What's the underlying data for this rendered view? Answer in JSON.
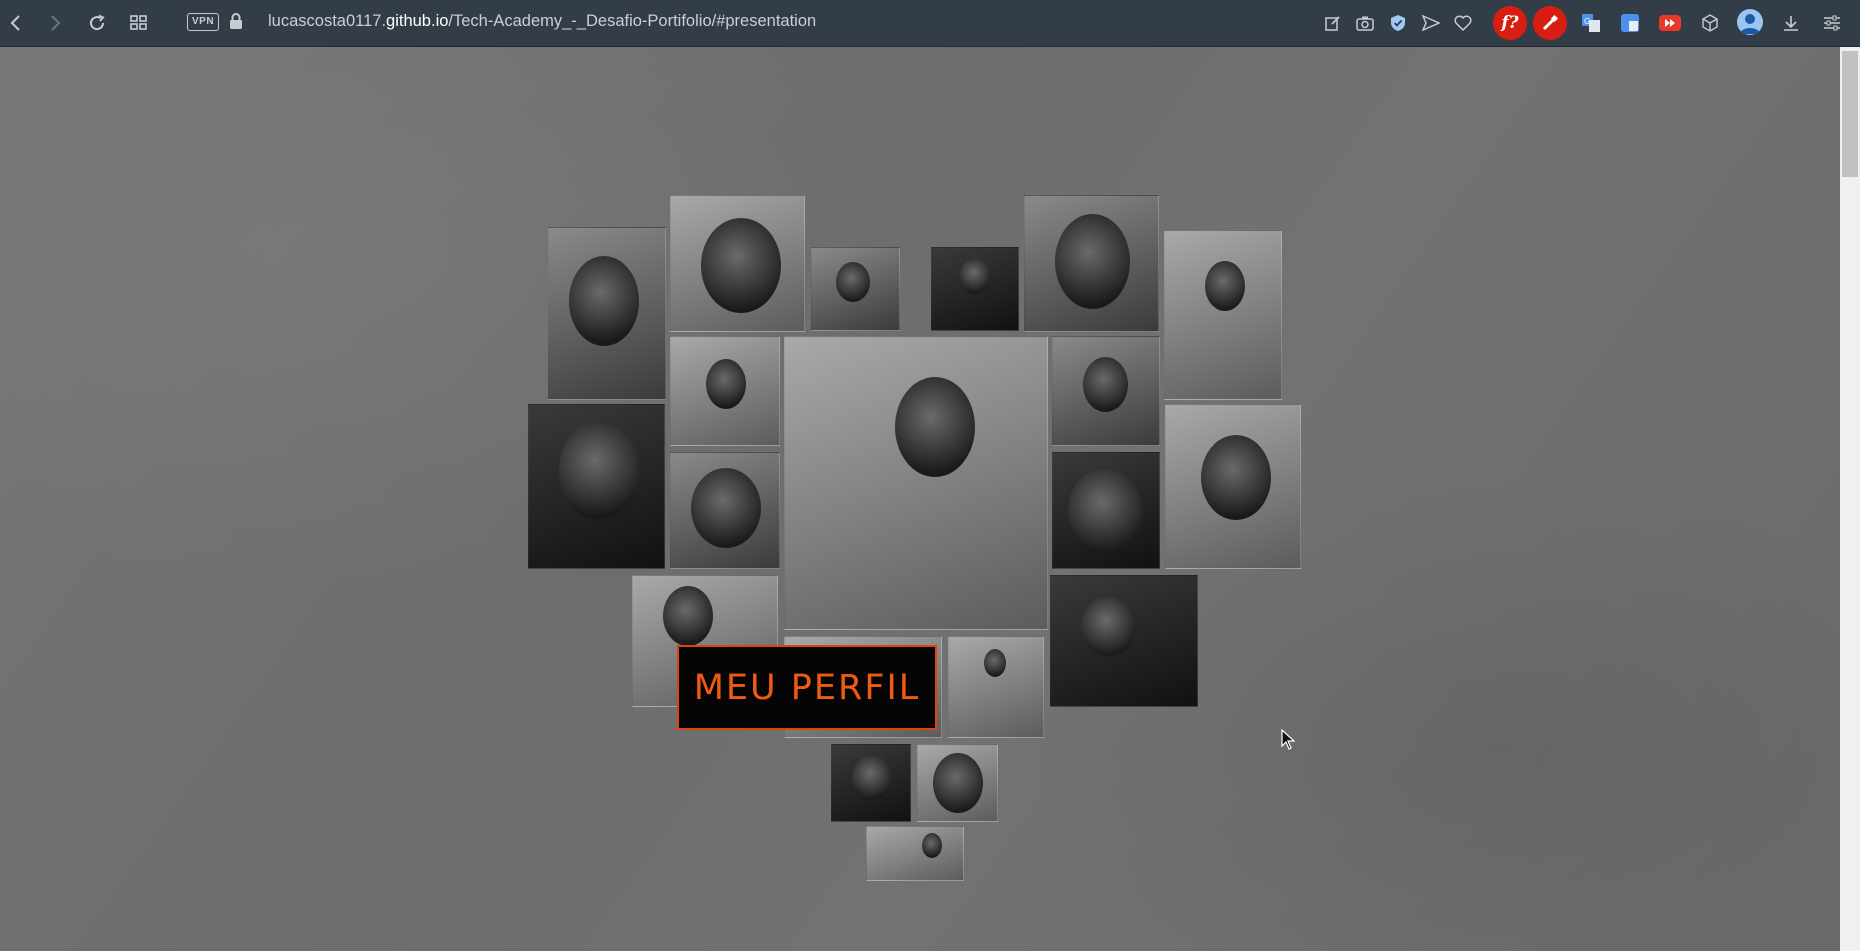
{
  "browser": {
    "url_prefix": "lucascosta0117.",
    "url_domain": "github.io",
    "url_path": "/Tech-Academy_-_Desafio-Portifolio/#presentation",
    "vpn_label": "VPN",
    "extension_f_label": "f?"
  },
  "page": {
    "profile_button_label": "MEU PERFIL",
    "accent_color": "#f05a12",
    "background_color": "#6f6f6f"
  },
  "collage": {
    "description_icons": [
      "portrait-photo",
      "portrait-photo",
      "portrait-photo",
      "portrait-photo",
      "portrait-photo"
    ]
  }
}
